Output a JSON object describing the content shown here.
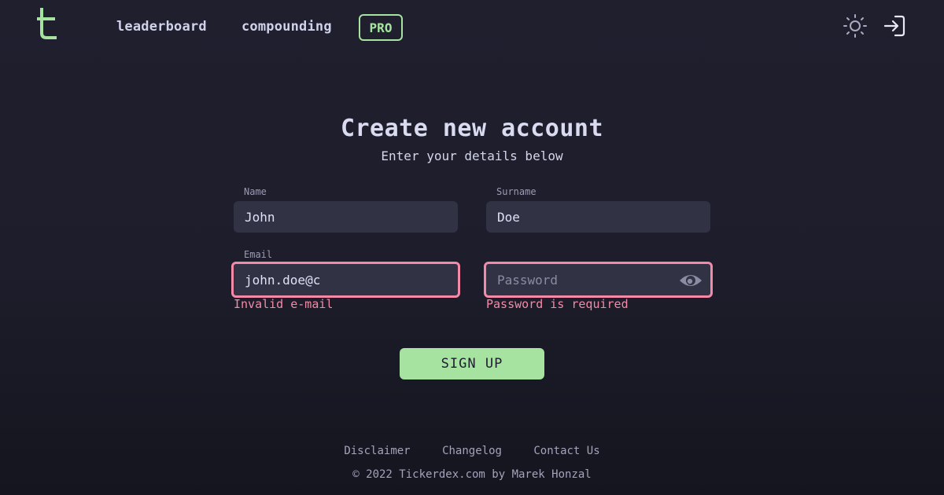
{
  "nav": {
    "logo_icon": "tickerdex-logo",
    "links": [
      "leaderboard",
      "compounding"
    ],
    "pro_badge": "PRO",
    "icons": [
      "sun-icon",
      "login-icon"
    ]
  },
  "form": {
    "title": "Create new account",
    "subtitle": "Enter your details below",
    "name": {
      "label": "Name",
      "value": "John"
    },
    "surname": {
      "label": "Surname",
      "value": "Doe"
    },
    "email": {
      "label": "Email",
      "value": "john.doe@c",
      "error": "Invalid e-mail"
    },
    "password": {
      "placeholder": "Password",
      "value": "",
      "error": "Password is required"
    },
    "submit_label": "SIGN UP"
  },
  "footer": {
    "links": [
      "Disclaimer",
      "Changelog",
      "Contact Us"
    ],
    "copyright": "© 2022 Tickerdex.com by Marek Honzal"
  },
  "colors": {
    "accent": "#a6e3a1",
    "error": "#f38ba8",
    "input_bg": "#313244",
    "background": "#1e1e2e"
  }
}
